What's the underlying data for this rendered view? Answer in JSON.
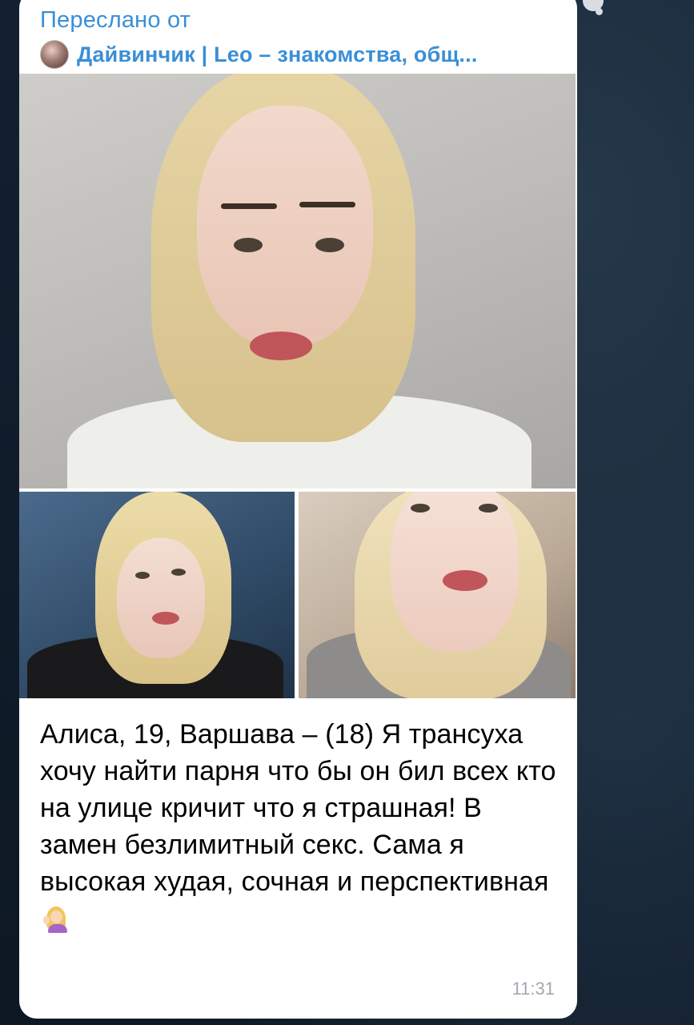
{
  "message": {
    "forwarded_label": "Переслано от",
    "source_name": "Дайвинчик | Leo – знакомства, общ...",
    "avatar_icon": "channel-avatar",
    "photos": [
      "profile-photo-main",
      "profile-photo-2",
      "profile-photo-3"
    ],
    "caption": "Алиса, 19, Варшава – (18) Я трансуха хочу найти парня что бы он бил всех кто на улице кричит что я страшная! В замен безлимитный секс. Сама я высокая худая, сочная и перспективная",
    "emoji_icon": "woman-tipping-hand-emoji",
    "time": "11:31"
  },
  "colors": {
    "accent": "#3a8fd6",
    "bubble": "#ffffff",
    "background": "#0f1a26",
    "timestamp": "#a2a9b0"
  }
}
